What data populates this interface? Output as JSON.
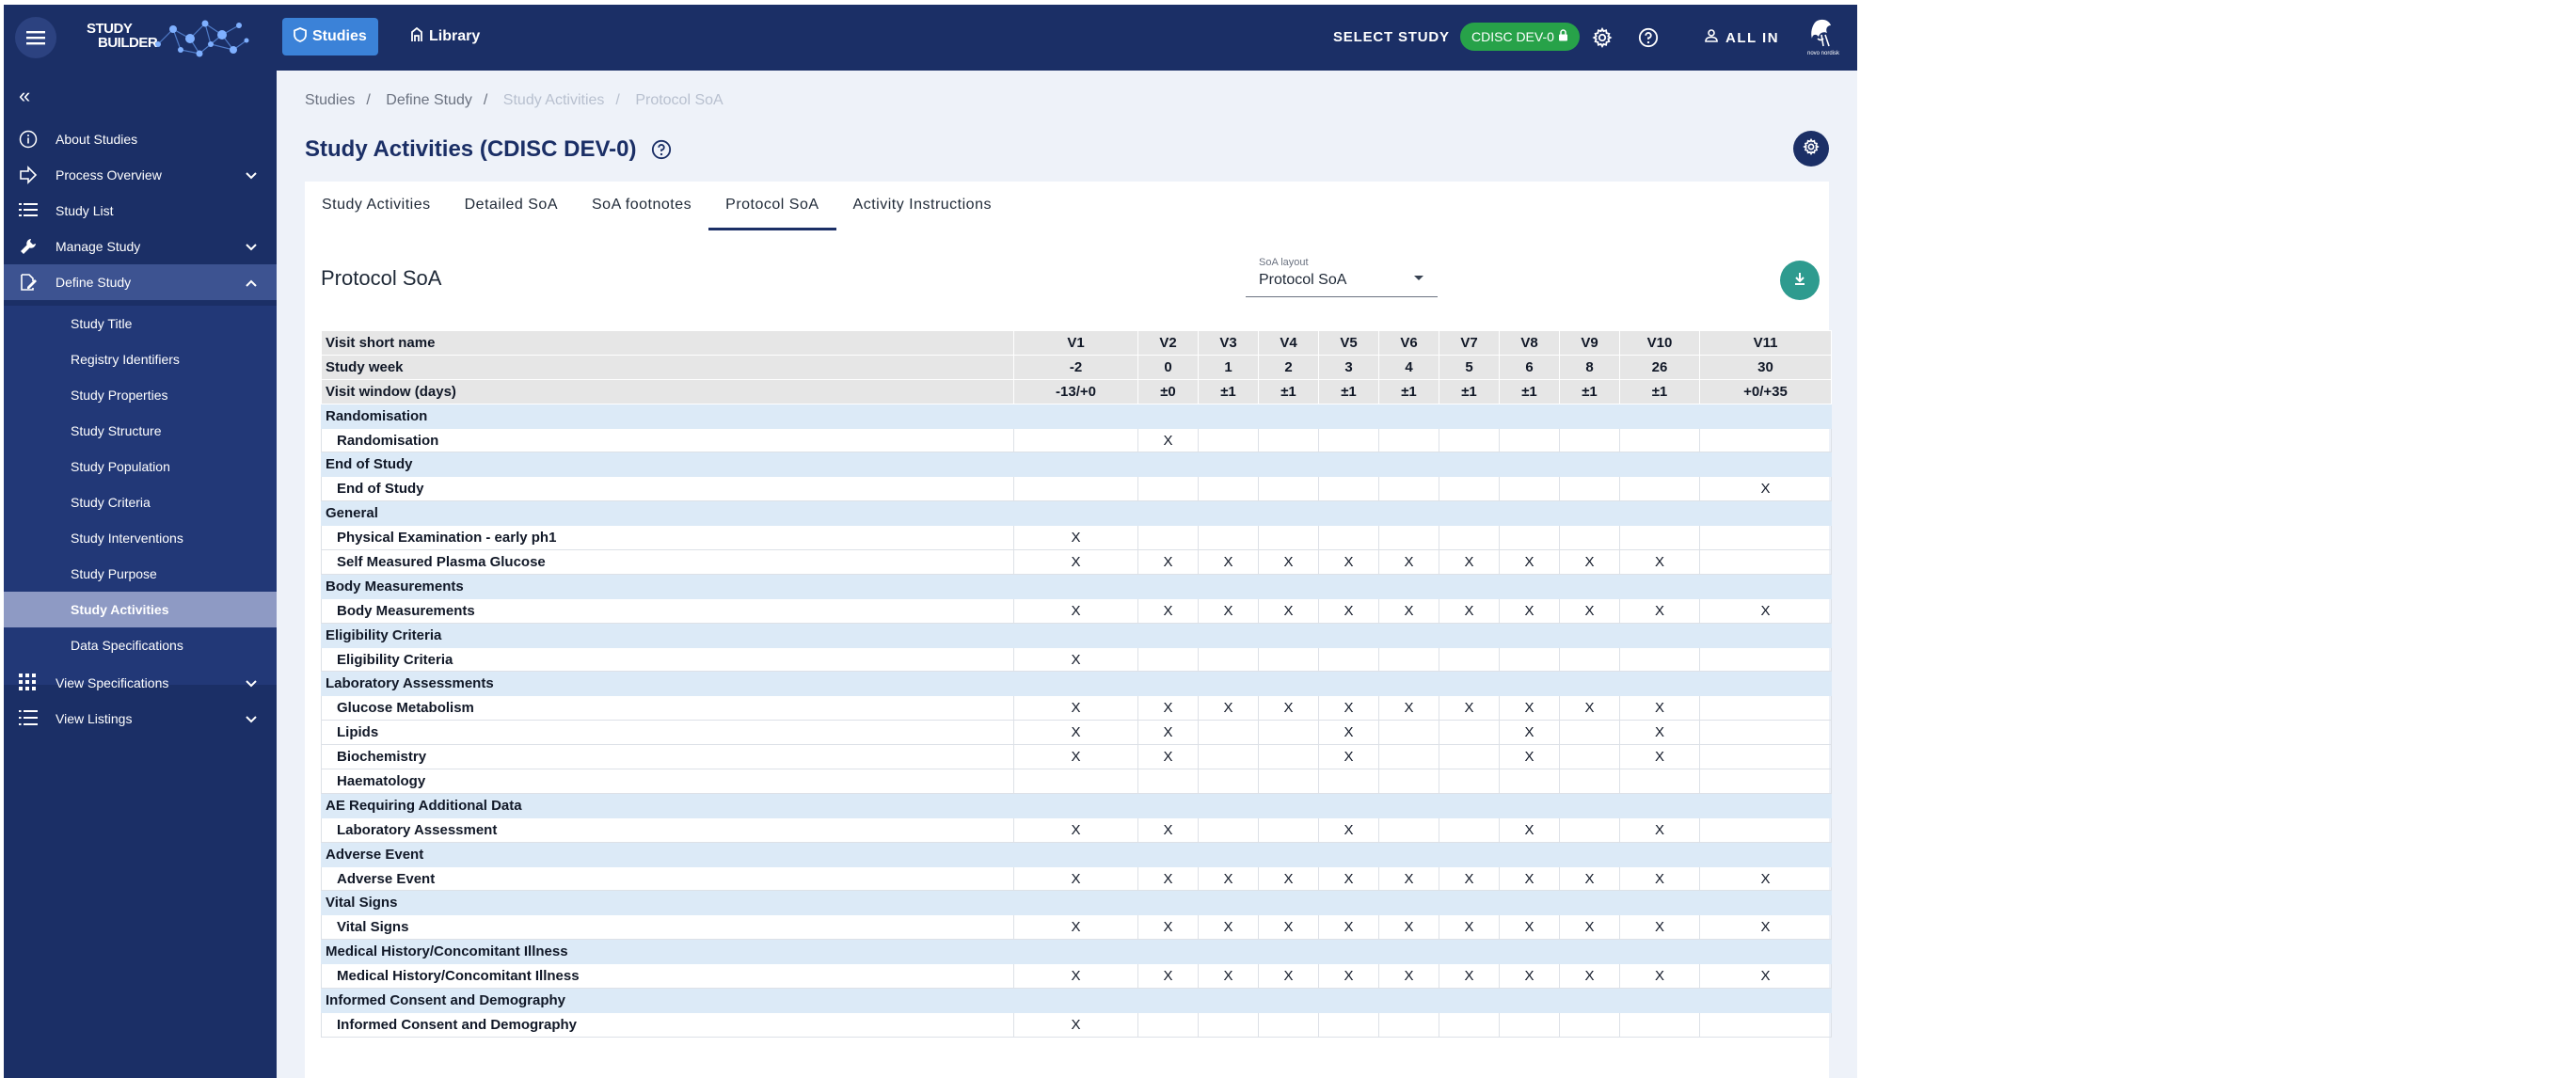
{
  "app": {
    "logo_text_1": "STUDY",
    "logo_text_2": "BUILDER",
    "nav_studies": "Studies",
    "nav_library": "Library",
    "select_study": "SELECT STUDY",
    "study_chip": "CDISC DEV-0",
    "user": "ALL IN",
    "company_logo_text": "novo nordisk"
  },
  "sidebar": {
    "items": [
      {
        "label": "About Studies",
        "icon": "info-icon"
      },
      {
        "label": "Process Overview",
        "icon": "arrow-icon"
      },
      {
        "label": "Study List",
        "icon": "list-icon"
      },
      {
        "label": "Manage Study",
        "icon": "wrench-icon"
      },
      {
        "label": "Define Study",
        "icon": "edit-document-icon"
      },
      {
        "label": "View Specifications",
        "icon": "grid-icon"
      },
      {
        "label": "View Listings",
        "icon": "listing-icon"
      }
    ],
    "define_sub": [
      "Study Title",
      "Registry Identifiers",
      "Study Properties",
      "Study Structure",
      "Study Population",
      "Study Criteria",
      "Study Interventions",
      "Study Purpose",
      "Study Activities",
      "Data Specifications"
    ]
  },
  "breadcrumb": [
    "Studies",
    "Define Study",
    "Study Activities",
    "Protocol SoA"
  ],
  "page_title": "Study Activities (CDISC DEV-0)",
  "tabs": [
    "Study Activities",
    "Detailed SoA",
    "SoA footnotes",
    "Protocol SoA",
    "Activity Instructions"
  ],
  "soa": {
    "title": "Protocol SoA",
    "layout_caption": "SoA layout",
    "layout_value": "Protocol SoA",
    "header_rows": [
      {
        "label": "Visit short name",
        "values": [
          "V1",
          "V2",
          "V3",
          "V4",
          "V5",
          "V6",
          "V7",
          "V8",
          "V9",
          "V10",
          "V11"
        ]
      },
      {
        "label": "Study week",
        "values": [
          "-2",
          "0",
          "1",
          "2",
          "3",
          "4",
          "5",
          "6",
          "8",
          "26",
          "30"
        ]
      },
      {
        "label": "Visit window (days)",
        "values": [
          "-13/+0",
          "±0",
          "±1",
          "±1",
          "±1",
          "±1",
          "±1",
          "±1",
          "±1",
          "±1",
          "+0/+35"
        ]
      }
    ],
    "groups": [
      {
        "name": "Randomisation",
        "rows": [
          {
            "name": "Randomisation",
            "marks": [
              "",
              "X",
              "",
              "",
              "",
              "",
              "",
              "",
              "",
              "",
              ""
            ]
          }
        ]
      },
      {
        "name": "End of Study",
        "rows": [
          {
            "name": "End of Study",
            "marks": [
              "",
              "",
              "",
              "",
              "",
              "",
              "",
              "",
              "",
              "",
              "X"
            ]
          }
        ]
      },
      {
        "name": "General",
        "rows": [
          {
            "name": "Physical Examination - early ph1",
            "marks": [
              "X",
              "",
              "",
              "",
              "",
              "",
              "",
              "",
              "",
              "",
              ""
            ]
          },
          {
            "name": "Self Measured Plasma Glucose",
            "marks": [
              "X",
              "X",
              "X",
              "X",
              "X",
              "X",
              "X",
              "X",
              "X",
              "X",
              ""
            ]
          }
        ]
      },
      {
        "name": "Body Measurements",
        "rows": [
          {
            "name": "Body Measurements",
            "marks": [
              "X",
              "X",
              "X",
              "X",
              "X",
              "X",
              "X",
              "X",
              "X",
              "X",
              "X"
            ]
          }
        ]
      },
      {
        "name": "Eligibility Criteria",
        "rows": [
          {
            "name": "Eligibility Criteria",
            "marks": [
              "X",
              "",
              "",
              "",
              "",
              "",
              "",
              "",
              "",
              "",
              ""
            ]
          }
        ]
      },
      {
        "name": "Laboratory Assessments",
        "rows": [
          {
            "name": "Glucose Metabolism",
            "marks": [
              "X",
              "X",
              "X",
              "X",
              "X",
              "X",
              "X",
              "X",
              "X",
              "X",
              ""
            ]
          },
          {
            "name": "Lipids",
            "marks": [
              "X",
              "X",
              "",
              "",
              "X",
              "",
              "",
              "X",
              "",
              "X",
              ""
            ]
          },
          {
            "name": "Biochemistry",
            "marks": [
              "X",
              "X",
              "",
              "",
              "X",
              "",
              "",
              "X",
              "",
              "X",
              ""
            ]
          },
          {
            "name": "Haematology",
            "marks": [
              "",
              "",
              "",
              "",
              "",
              "",
              "",
              "",
              "",
              "",
              ""
            ]
          }
        ]
      },
      {
        "name": "AE Requiring Additional Data",
        "rows": [
          {
            "name": "Laboratory Assessment",
            "marks": [
              "X",
              "X",
              "",
              "",
              "X",
              "",
              "",
              "X",
              "",
              "X",
              ""
            ]
          }
        ]
      },
      {
        "name": "Adverse Event",
        "rows": [
          {
            "name": "Adverse Event",
            "marks": [
              "X",
              "X",
              "X",
              "X",
              "X",
              "X",
              "X",
              "X",
              "X",
              "X",
              "X"
            ]
          }
        ]
      },
      {
        "name": "Vital Signs",
        "rows": [
          {
            "name": "Vital Signs",
            "marks": [
              "X",
              "X",
              "X",
              "X",
              "X",
              "X",
              "X",
              "X",
              "X",
              "X",
              "X"
            ]
          }
        ]
      },
      {
        "name": "Medical History/Concomitant Illness",
        "rows": [
          {
            "name": "Medical History/Concomitant Illness",
            "marks": [
              "X",
              "X",
              "X",
              "X",
              "X",
              "X",
              "X",
              "X",
              "X",
              "X",
              "X"
            ]
          }
        ]
      },
      {
        "name": "Informed Consent and Demography",
        "rows": [
          {
            "name": "Informed Consent and Demography",
            "marks": [
              "X",
              "",
              "",
              "",
              "",
              "",
              "",
              "",
              "",
              "",
              ""
            ]
          }
        ]
      }
    ]
  },
  "colors": {
    "navy": "#1b2f66",
    "studies_btn": "#3b82d8",
    "chip_green": "#27a249",
    "group_row": "#dceaf7",
    "header_row": "#e6e6e6",
    "download_fab": "#2e9b8f"
  }
}
